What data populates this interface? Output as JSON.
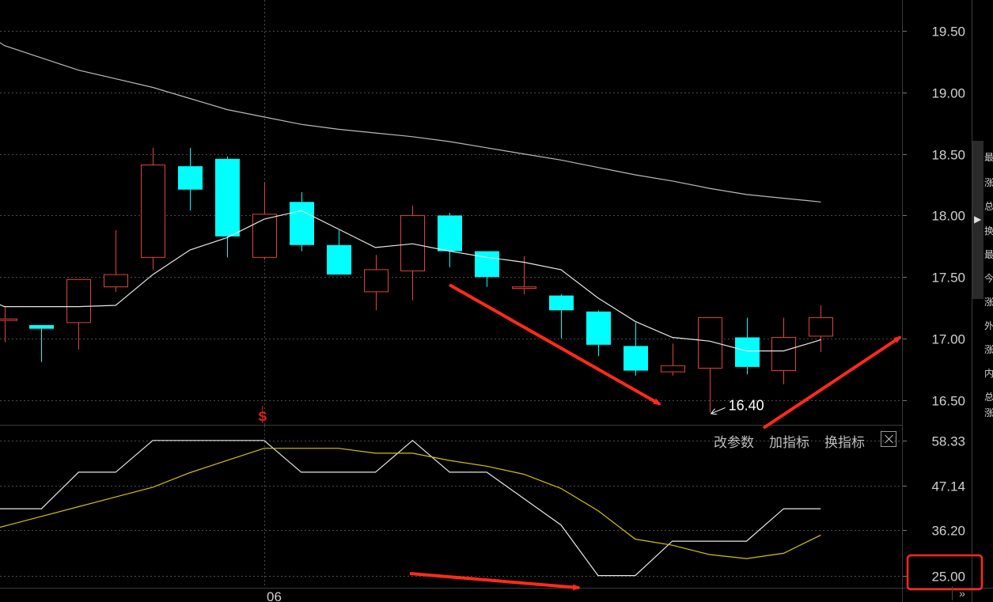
{
  "chart_data": [
    {
      "type": "candlestick",
      "panel": "price",
      "ylim": [
        16.3,
        19.75
      ],
      "y_ticks": [
        16.5,
        17.0,
        17.5,
        18.0,
        18.5,
        19.0,
        19.5
      ],
      "y_tick_labels": [
        "16.50",
        "17.00",
        "17.50",
        "18.00",
        "18.50",
        "19.00",
        "19.50"
      ],
      "x_tick_labels": [
        "06"
      ],
      "grid": true,
      "colors": {
        "up": "#e0433d",
        "down": "#00ffff",
        "ma_short": "#e6e6e6",
        "ma_long": "#b9b9b9",
        "grid": "#4a4a4a"
      },
      "candles": [
        {
          "open": 17.16,
          "close": 17.16,
          "high": 17.26,
          "low": 16.97
        },
        {
          "open": 17.11,
          "close": 17.08,
          "high": 17.11,
          "low": 16.81
        },
        {
          "open": 17.13,
          "close": 17.48,
          "high": 17.48,
          "low": 16.91
        },
        {
          "open": 17.42,
          "close": 17.52,
          "high": 17.88,
          "low": 17.38
        },
        {
          "open": 17.66,
          "close": 18.41,
          "high": 18.55,
          "low": 17.56
        },
        {
          "open": 18.4,
          "close": 18.21,
          "high": 18.55,
          "low": 18.04
        },
        {
          "open": 18.46,
          "close": 17.83,
          "high": 18.48,
          "low": 17.66
        },
        {
          "open": 17.66,
          "close": 18.01,
          "high": 18.27,
          "low": 17.64
        },
        {
          "open": 18.11,
          "close": 17.76,
          "high": 18.19,
          "low": 17.71
        },
        {
          "open": 17.76,
          "close": 17.52,
          "high": 17.88,
          "low": 17.52
        },
        {
          "open": 17.38,
          "close": 17.56,
          "high": 17.68,
          "low": 17.23
        },
        {
          "open": 17.55,
          "close": 18.0,
          "high": 18.08,
          "low": 17.31
        },
        {
          "open": 18.0,
          "close": 17.71,
          "high": 18.02,
          "low": 17.58
        },
        {
          "open": 17.71,
          "close": 17.5,
          "high": 17.71,
          "low": 17.42
        },
        {
          "open": 17.42,
          "close": 17.42,
          "high": 17.67,
          "low": 17.36
        },
        {
          "open": 17.35,
          "close": 17.23,
          "high": 17.36,
          "low": 17.0
        },
        {
          "open": 17.22,
          "close": 16.95,
          "high": 17.23,
          "low": 16.86
        },
        {
          "open": 16.94,
          "close": 16.74,
          "high": 17.13,
          "low": 16.7
        },
        {
          "open": 16.73,
          "close": 16.78,
          "high": 16.96,
          "low": 16.7
        },
        {
          "open": 16.76,
          "close": 17.17,
          "high": 17.17,
          "low": 16.4
        },
        {
          "open": 17.01,
          "close": 16.77,
          "high": 17.17,
          "low": 16.71
        },
        {
          "open": 16.74,
          "close": 17.01,
          "high": 17.17,
          "low": 16.63
        },
        {
          "open": 17.02,
          "close": 17.17,
          "high": 17.27,
          "low": 16.89
        }
      ],
      "ma_short": {
        "start_index": -1,
        "values": [
          17.39,
          17.26,
          17.26,
          17.26,
          17.27,
          17.52,
          17.72,
          17.82,
          17.97,
          18.04,
          17.89,
          17.74,
          17.77,
          17.71,
          17.66,
          17.62,
          17.56,
          17.33,
          17.14,
          17.01,
          16.98,
          16.9,
          16.9,
          16.99
        ]
      },
      "ma_long": {
        "start_index": -1,
        "values": [
          19.58,
          19.38,
          19.28,
          19.18,
          19.11,
          19.04,
          18.95,
          18.86,
          18.8,
          18.74,
          18.7,
          18.67,
          18.64,
          18.6,
          18.55,
          18.5,
          18.45,
          18.39,
          18.33,
          18.28,
          18.22,
          18.17,
          18.14,
          18.11
        ]
      },
      "annotations": [
        {
          "text": "16.40",
          "candle_index": 19,
          "value": 16.4,
          "color": "#ffffff"
        },
        {
          "text": "S",
          "candle_index": 7,
          "color": "#e0221d"
        }
      ]
    },
    {
      "type": "line",
      "panel": "indicator",
      "ylim": [
        22.0,
        62.0
      ],
      "y_ticks": [
        25.0,
        36.2,
        47.14,
        58.33
      ],
      "y_tick_labels": [
        "25.00",
        "36.20",
        "47.14",
        "58.33"
      ],
      "grid": true,
      "series": [
        {
          "color": "#e6e6e6",
          "x": [
            -1,
            0,
            1,
            2,
            3,
            4,
            5,
            6,
            7,
            8,
            9,
            10,
            11,
            12,
            13,
            14,
            15,
            16,
            17,
            18,
            19,
            20,
            21,
            22
          ],
          "values": [
            41.5,
            41.5,
            41.5,
            50.5,
            50.5,
            58.33,
            58.33,
            58.33,
            58.33,
            50.5,
            50.5,
            50.5,
            58.33,
            50.5,
            50.5,
            44.0,
            37.5,
            25.0,
            25.0,
            33.5,
            33.5,
            33.5,
            41.5,
            41.5
          ]
        },
        {
          "color": "#d2c400",
          "x": [
            -1,
            0,
            1,
            2,
            3,
            4,
            5,
            6,
            7,
            8,
            9,
            10,
            11,
            12,
            13,
            14,
            15,
            16,
            17,
            18,
            19,
            20,
            21,
            22
          ],
          "values": [
            34.8,
            37.2,
            39.6,
            42.0,
            44.4,
            46.8,
            50.4,
            53.4,
            56.4,
            56.4,
            56.4,
            55.2,
            55.2,
            53.4,
            52.0,
            50.0,
            46.5,
            41.0,
            34.0,
            32.5,
            30.2,
            29.2,
            30.5,
            35.0
          ]
        }
      ]
    }
  ],
  "toolbar": {
    "change_params": "改参数",
    "add_indicator": "加指标",
    "switch_indicator": "换指标"
  },
  "side_glyphs": [
    "最",
    "涨",
    "总",
    "换",
    "最",
    "今",
    "涨",
    "外",
    "涨",
    "内",
    "总",
    "涨"
  ]
}
